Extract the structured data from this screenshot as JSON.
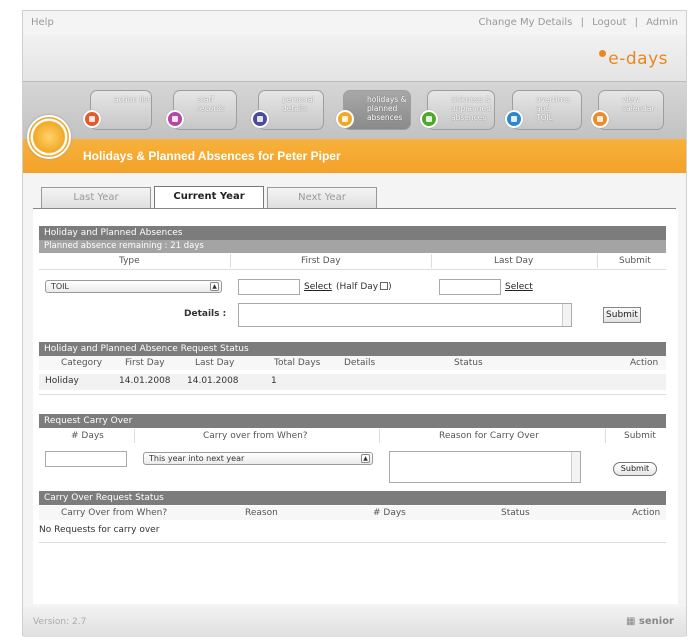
{
  "topbar": {
    "help": "Help",
    "change_details": "Change My Details",
    "logout": "Logout",
    "admin": "Admin",
    "separator": "|"
  },
  "brand": {
    "logo_text": "e-days",
    "accent_color": "#e8871c"
  },
  "nav": [
    {
      "line1": "action list",
      "line2": "",
      "line3": "",
      "icon": "clipboard-icon",
      "color": "#e45a2c"
    },
    {
      "line1": "staff",
      "line2": "records",
      "line3": "",
      "icon": "people-icon",
      "color": "#b646a5"
    },
    {
      "line1": "personal",
      "line2": "details",
      "line3": "",
      "icon": "person-icon",
      "color": "#4b4b9e"
    },
    {
      "line1": "holidays &",
      "line2": "planned",
      "line3": "absences",
      "icon": "sun-icon",
      "color": "#f2a827"
    },
    {
      "line1": "sickness &",
      "line2": "unplanned",
      "line3": "absences",
      "icon": "medical-icon",
      "color": "#4fa82a"
    },
    {
      "line1": "overtime and",
      "line2": "TOIL",
      "line3": "",
      "icon": "clock-icon",
      "color": "#2b87cf"
    },
    {
      "line1": "view",
      "line2": "calendar",
      "line3": "",
      "icon": "calendar-icon",
      "color": "#f08a28"
    }
  ],
  "page": {
    "title": "Holidays & Planned Absences for Peter Piper"
  },
  "year_tabs": {
    "last": "Last Year",
    "current": "Current Year",
    "next": "Next Year"
  },
  "planned": {
    "heading": "Holiday and Planned Absences",
    "remaining": "Planned absence remaining : 21 days",
    "col_type": "Type",
    "col_first": "First Day",
    "col_last": "Last Day",
    "col_submit": "Submit",
    "type_value": "TOIL",
    "select_first": "Select",
    "half_day": "(Half Day",
    "half_day_close": ")",
    "select_last": "Select",
    "details_label": "Details :",
    "submit": "Submit"
  },
  "request_status": {
    "heading": "Holiday and Planned Absence Request Status",
    "cols": {
      "category": "Category",
      "first": "First Day",
      "last": "Last Day",
      "total": "Total Days",
      "details": "Details",
      "status": "Status",
      "action": "Action"
    },
    "rows": [
      {
        "category": "Holiday",
        "first": "14.01.2008",
        "last": "14.01.2008",
        "total": "1"
      }
    ]
  },
  "carry_over": {
    "heading": "Request Carry Over",
    "col_days": "# Days",
    "col_when": "Carry over from When?",
    "col_reason": "Reason for Carry Over",
    "col_submit": "Submit",
    "when_value": "This year into next year",
    "submit": "Submit"
  },
  "carry_status": {
    "heading": "Carry Over Request Status",
    "cols": {
      "when": "Carry Over from When?",
      "reason": "Reason",
      "days": "# Days",
      "status": "Status",
      "action": "Action"
    },
    "empty": "No Requests for carry over"
  },
  "footer": {
    "version": "Version: 2.7",
    "brand": "senior"
  }
}
